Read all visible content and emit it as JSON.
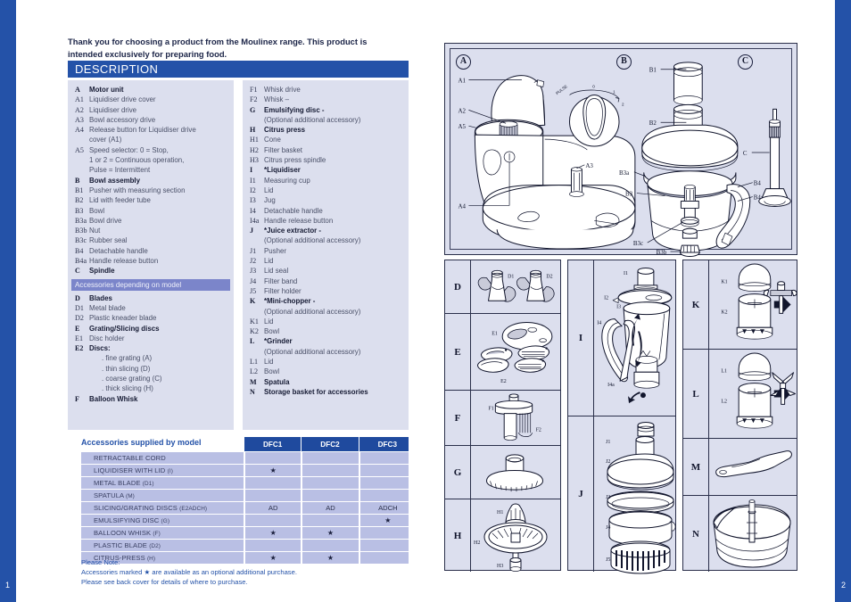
{
  "folio": {
    "left": "1",
    "right": "2"
  },
  "intro": "Thank you for choosing a product from the Moulinex range. This product is intended exclusively for preparing food.",
  "section": {
    "title": "DESCRIPTION"
  },
  "colors": {
    "brand_blue": "#2452a8",
    "header_blue": "#1f4a9e",
    "panel_lavender": "#dcdfee",
    "list_lavender": "#dcdfee",
    "subhead_violet": "#7b85ca",
    "table_cell": "#b9bfe4",
    "ink": "#11152c"
  },
  "description": {
    "left_items": [
      {
        "key": "A",
        "text": "Motor unit",
        "bold": true
      },
      {
        "key": "A1",
        "text": "Liquidiser drive cover"
      },
      {
        "key": "A2",
        "text": "Liquidiser drive"
      },
      {
        "key": "A3",
        "text": "Bowl accessory drive"
      },
      {
        "key": "A4",
        "text": "Release button for Liquidiser drive",
        "cont": "cover (A1)"
      },
      {
        "key": "A5",
        "text": "Speed selector: 0 = Stop,",
        "cont": "1 or 2 = Continuous operation,",
        "cont2": "Pulse = Intermittent"
      },
      {
        "key": "B",
        "text": "Bowl assembly",
        "bold": true
      },
      {
        "key": "B1",
        "text": "Pusher with measuring section"
      },
      {
        "key": "B2",
        "text": "Lid with feeder tube"
      },
      {
        "key": "B3",
        "text": "Bowl"
      },
      {
        "key": "B3a",
        "text": "Bowl drive"
      },
      {
        "key": "B3b",
        "text": "Nut"
      },
      {
        "key": "B3c",
        "text": "Rubber seal"
      },
      {
        "key": "B4",
        "text": "Detachable handle"
      },
      {
        "key": "B4a",
        "text": "Handle release button"
      },
      {
        "key": "C",
        "text": "Spindle",
        "bold": true
      }
    ],
    "subheader": "Accessories depending on model",
    "left_items2": [
      {
        "key": "D",
        "text": "Blades",
        "bold": true
      },
      {
        "key": "D1",
        "text": "Metal blade"
      },
      {
        "key": "D2",
        "text": "Plastic kneader blade"
      },
      {
        "key": "E",
        "text": "Grating/Slicing discs",
        "bold": true
      },
      {
        "key": "E1",
        "text": "Disc holder"
      },
      {
        "key": "E2",
        "text": "Discs:",
        "bold": true
      },
      {
        "key": "",
        "text": ". fine grating (A)",
        "sub": true
      },
      {
        "key": "",
        "text": ". thin slicing (D)",
        "sub": true
      },
      {
        "key": "",
        "text": ". coarse grating (C)",
        "sub": true
      },
      {
        "key": "",
        "text": ". thick slicing (H)",
        "sub": true
      },
      {
        "key": "F",
        "text": "Balloon Whisk",
        "bold": true
      }
    ],
    "right_items": [
      {
        "key": "F1",
        "text": "Whisk drive"
      },
      {
        "key": "F2",
        "text": "Whisk –"
      },
      {
        "key": "G",
        "text": "Emulsifying disc -",
        "bold": true,
        "paren": "(Optional additional accessory)"
      },
      {
        "key": "H",
        "text": "Citrus press",
        "bold": true
      },
      {
        "key": "H1",
        "text": "Cone"
      },
      {
        "key": "H2",
        "text": "Filter basket"
      },
      {
        "key": "H3",
        "text": "Citrus press spindle"
      },
      {
        "key": "I",
        "text": "*Liquidiser",
        "bold": true
      },
      {
        "key": "I1",
        "text": "Measuring cup"
      },
      {
        "key": "I2",
        "text": "Lid"
      },
      {
        "key": "I3",
        "text": "Jug"
      },
      {
        "key": "I4",
        "text": "Detachable handle"
      },
      {
        "key": "I4a",
        "text": "Handle release button"
      },
      {
        "key": "J",
        "text": "*Juice extractor -",
        "bold": true,
        "paren": "(Optional additional accessory)"
      },
      {
        "key": "J1",
        "text": "Pusher"
      },
      {
        "key": "J2",
        "text": "Lid"
      },
      {
        "key": "J3",
        "text": "Lid seal"
      },
      {
        "key": "J4",
        "text": "Filter band"
      },
      {
        "key": "J5",
        "text": "Filter holder"
      },
      {
        "key": "K",
        "text": "*Mini-chopper -",
        "bold": true,
        "paren": "(Optional additional accessory)"
      },
      {
        "key": "K1",
        "text": "Lid"
      },
      {
        "key": "K2",
        "text": "Bowl"
      },
      {
        "key": "L",
        "text": "*Grinder",
        "bold": true,
        "paren": "(Optional additional accessory)"
      },
      {
        "key": "L1",
        "text": "Lid"
      },
      {
        "key": "L2",
        "text": "Bowl"
      },
      {
        "key": "M",
        "text": "Spatula",
        "bold": true
      },
      {
        "key": "N",
        "text": "Storage basket for accessories",
        "bold": true
      }
    ]
  },
  "supply_table": {
    "title": "Accessories supplied by model",
    "columns": [
      "DFC1",
      "DFC2",
      "DFC3"
    ],
    "rows": [
      {
        "label": "RETRACTABLE CORD",
        "suffix": "",
        "cells": [
          "",
          "",
          ""
        ]
      },
      {
        "label": "LIQUIDISER WITH LID",
        "suffix": "(I)",
        "cells": [
          "★",
          "",
          ""
        ]
      },
      {
        "label": "METAL BLADE",
        "suffix": "(D1)",
        "cells": [
          "",
          "",
          ""
        ]
      },
      {
        "label": "SPATULA",
        "suffix": "(M)",
        "cells": [
          "",
          "",
          ""
        ]
      },
      {
        "label": "SLICING/GRATING DISCS",
        "suffix": "(E2ADCH)",
        "cells": [
          "AD",
          "AD",
          "ADCH"
        ]
      },
      {
        "label": "EMULSIFYING DISC",
        "suffix": "(G)",
        "cells": [
          "",
          "",
          "★"
        ]
      },
      {
        "label": "BALLOON WHISK",
        "suffix": "(F)",
        "cells": [
          "★",
          "★",
          ""
        ]
      },
      {
        "label": "PLASTIC BLADE",
        "suffix": "(D2)",
        "cells": [
          "",
          "",
          ""
        ]
      },
      {
        "label": "CITRUS-PRESS",
        "suffix": "(H)",
        "cells": [
          "★",
          "★",
          ""
        ]
      }
    ]
  },
  "note": {
    "line1": "Please Note:",
    "line2": "Accessories marked ★ are available as an optional additional purchase.",
    "line3": "Please see back cover for details of where to purchase."
  },
  "figures": {
    "top": {
      "groups": [
        "A",
        "B",
        "C"
      ],
      "labels_a": [
        "A1",
        "A2",
        "A5",
        "A3",
        "A4"
      ],
      "labels_b": [
        "B1",
        "B2",
        "B3a",
        "B3",
        "B4",
        "B4a",
        "B3c",
        "B3b"
      ],
      "labels_c": [
        "C"
      ],
      "dial": [
        "PULSE",
        "0",
        "1",
        "2"
      ]
    },
    "grid_left": [
      {
        "key": "D",
        "labels": [
          "D1",
          "D2"
        ]
      },
      {
        "key": "E",
        "labels": [
          "E1",
          "E2"
        ]
      },
      {
        "key": "F",
        "labels": [
          "F1",
          "F2"
        ]
      },
      {
        "key": "G",
        "labels": []
      },
      {
        "key": "H",
        "labels": [
          "H1",
          "H2",
          "H3"
        ]
      }
    ],
    "grid_mid": [
      {
        "key": "I",
        "labels": [
          "I1",
          "I2",
          "I3",
          "I4",
          "I4a"
        ]
      },
      {
        "key": "J",
        "labels": [
          "J1",
          "J2",
          "J3",
          "J4",
          "J5"
        ]
      }
    ],
    "grid_right": [
      {
        "key": "K",
        "labels": [
          "K1",
          "K2"
        ]
      },
      {
        "key": "L",
        "labels": [
          "L1",
          "L2"
        ]
      },
      {
        "key": "M",
        "labels": []
      },
      {
        "key": "N",
        "labels": []
      }
    ]
  }
}
